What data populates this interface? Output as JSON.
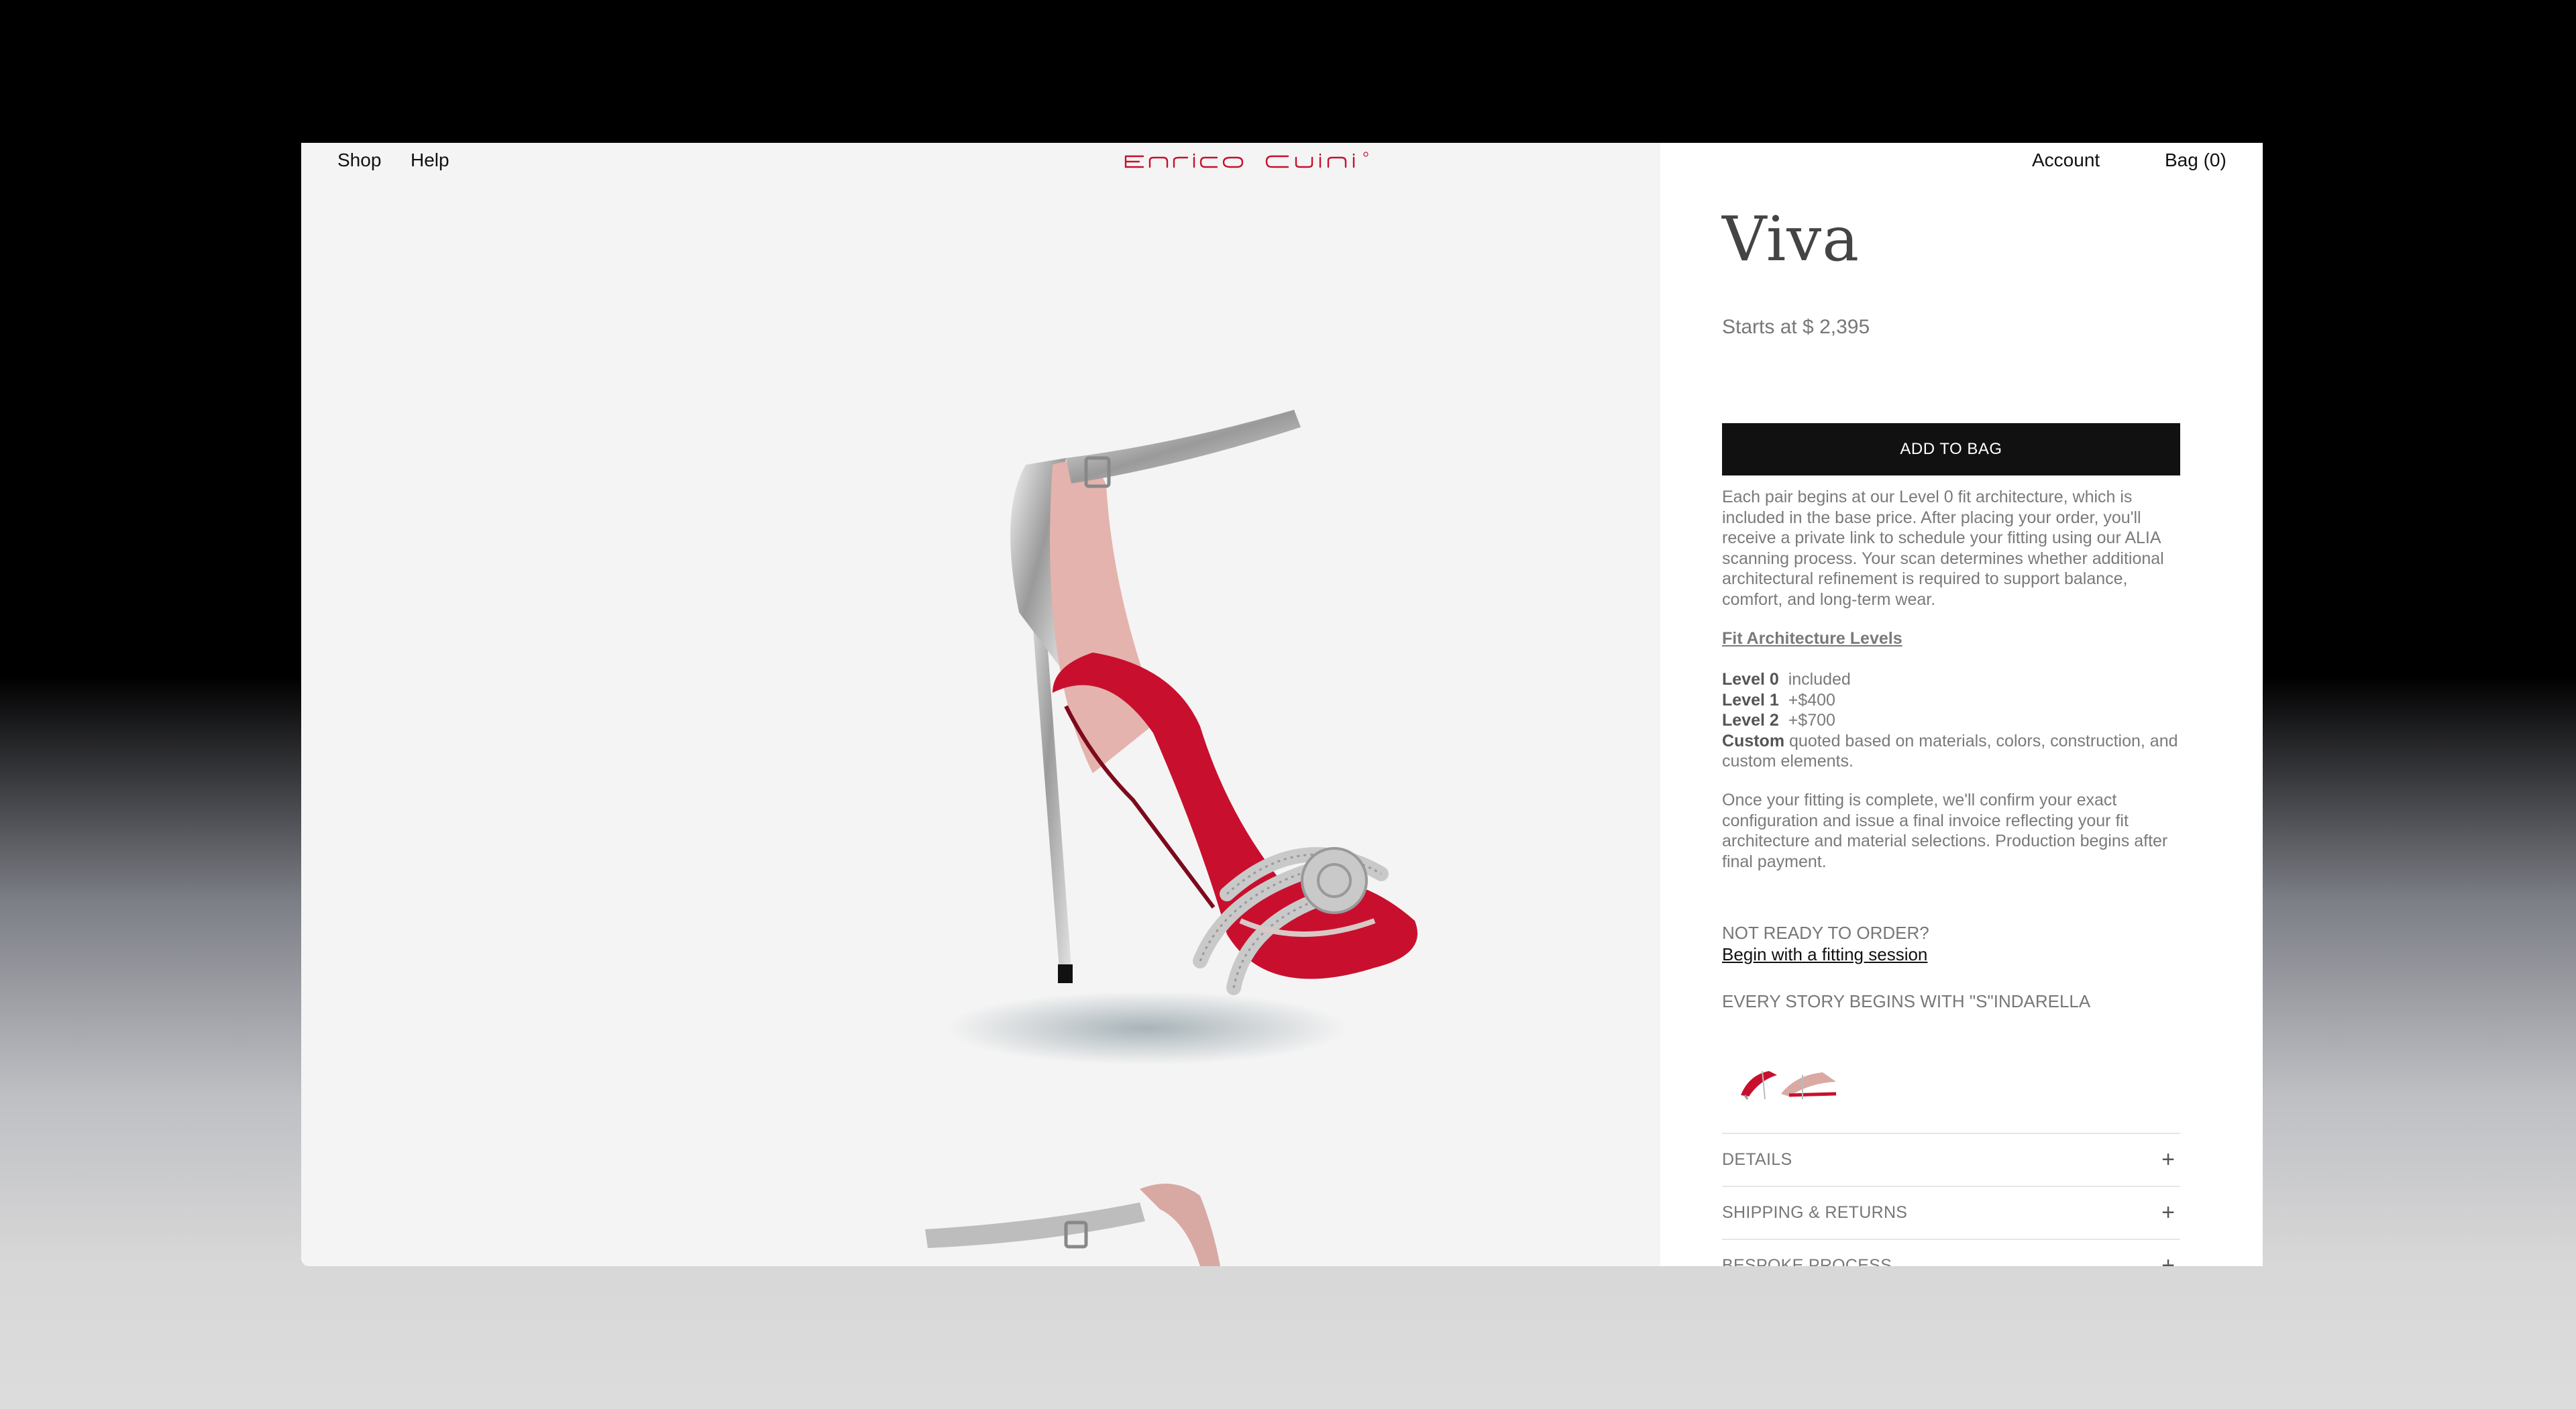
{
  "header": {
    "nav_left": [
      "Shop",
      "Help"
    ],
    "nav_right": {
      "account": "Account",
      "bag": "Bag (0)"
    },
    "logo_text": "Enrico Cuini"
  },
  "product": {
    "name": "Viva",
    "price": "Starts at $ 2,395",
    "add_to_bag": "ADD TO BAG",
    "description": "Each pair begins at our Level 0 fit architecture, which is included in the base price. After placing your order, you'll receive a private link to schedule your fitting using our ALIA scanning process. Your scan determines whether additional architectural refinement is required to support balance, comfort, and long-term wear.",
    "fit_link": "Fit Architecture Levels",
    "levels": [
      {
        "name": "Level 0",
        "value": "included"
      },
      {
        "name": "Level 1",
        "value": "+$400"
      },
      {
        "name": "Level 2",
        "value": "+$700"
      },
      {
        "name": "Custom",
        "value": "quoted based on materials, colors, construction, and custom elements."
      }
    ],
    "final_note": "Once your fitting is complete, we'll confirm your exact configuration and issue a final invoice reflecting your fit architecture and material selections. Production begins after final payment.",
    "not_ready": "NOT READY TO ORDER?",
    "fitting_link": "Begin with a fitting session",
    "story": "EVERY STORY BEGINS WITH \"S\"INDARELLA",
    "accordion": [
      "DETAILS",
      "SHIPPING & RETURNS",
      "BESPOKE PROCESS"
    ]
  },
  "colors": {
    "brand_red": "#c8102e",
    "button_black": "#111111",
    "gallery_bg": "#f4f4f4"
  }
}
